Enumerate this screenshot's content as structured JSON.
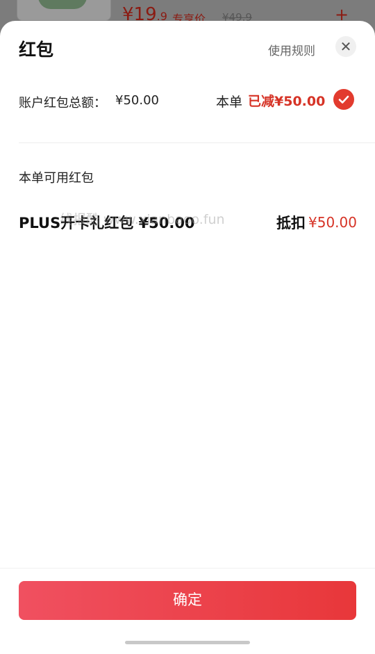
{
  "background": {
    "price_big": "¥19",
    "price_small": ".9",
    "price_tag": "专享价",
    "original_price": "¥49.9",
    "add_symbol": "+"
  },
  "sheet": {
    "title": "红包",
    "rules_link": "使用规则",
    "close_symbol": "✕",
    "balance_label": "账户红包总额：",
    "balance_value": "¥50.00",
    "order_label": "本单",
    "order_reduced": "已减¥50.00",
    "section_title": "本单可用红包",
    "coupon": {
      "name": "PLUS开卡礼红包 ¥50.00",
      "deduct_label": "抵扣",
      "deduct_value": "¥50.00"
    },
    "watermark": "线报酷 www.xianbaoo.fun",
    "confirm_label": "确定"
  },
  "colors": {
    "accent_red": "#d63326",
    "button_gradient_start": "#f05060",
    "button_gradient_end": "#e8373a"
  },
  "icons": [
    "close-icon",
    "check-circle-icon",
    "plus-icon"
  ]
}
